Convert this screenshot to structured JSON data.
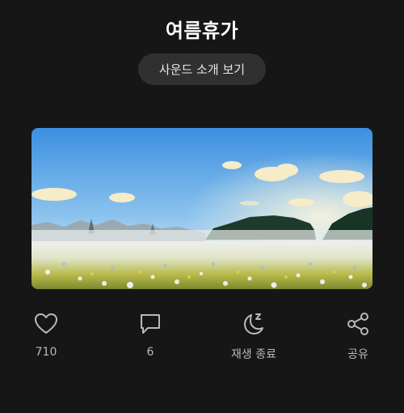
{
  "header": {
    "title": "여름휴가"
  },
  "sound_intro_button": {
    "label": "사운드 소개 보기"
  },
  "artwork": {
    "description_icon": "meadow-landscape-image"
  },
  "actions": {
    "like": {
      "icon": "heart-icon",
      "count": "710"
    },
    "comment": {
      "icon": "comment-icon",
      "count": "6"
    },
    "sleep_timer": {
      "icon": "moon-zzz-icon",
      "label": "재생 종료"
    },
    "share": {
      "icon": "share-icon",
      "label": "공유"
    }
  },
  "colors": {
    "background": "#161616",
    "button_bg": "#303030",
    "icon_color": "#b9b9b9"
  }
}
